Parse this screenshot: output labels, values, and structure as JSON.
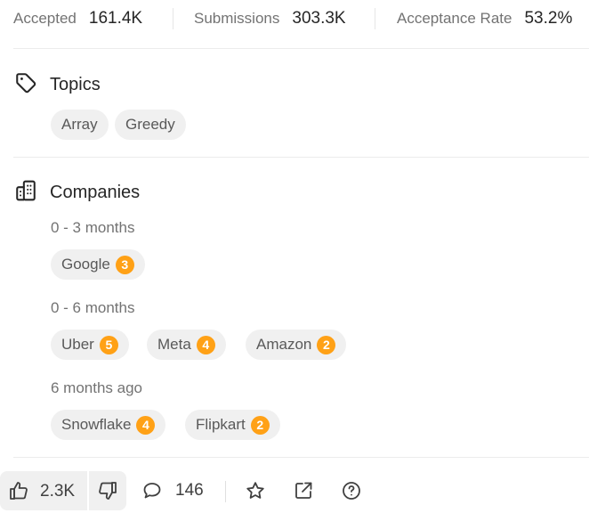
{
  "stats": [
    {
      "label": "Accepted",
      "value": "161.4K"
    },
    {
      "label": "Submissions",
      "value": "303.3K"
    },
    {
      "label": "Acceptance Rate",
      "value": "53.2%"
    }
  ],
  "topics": {
    "title": "Topics",
    "icon": "tag-icon",
    "items": [
      "Array",
      "Greedy"
    ]
  },
  "companies": {
    "title": "Companies",
    "icon": "building-icon",
    "groups": [
      {
        "period": "0 - 3 months",
        "items": [
          {
            "name": "Google",
            "count": "3"
          }
        ]
      },
      {
        "period": "0 - 6 months",
        "items": [
          {
            "name": "Uber",
            "count": "5"
          },
          {
            "name": "Meta",
            "count": "4"
          },
          {
            "name": "Amazon",
            "count": "2"
          }
        ]
      },
      {
        "period": "6 months ago",
        "items": [
          {
            "name": "Snowflake",
            "count": "4"
          },
          {
            "name": "Flipkart",
            "count": "2"
          }
        ]
      }
    ]
  },
  "actions": {
    "likes": "2.3K",
    "comments": "146",
    "icons": [
      "thumbs-up-icon",
      "thumbs-down-icon",
      "comment-icon",
      "star-icon",
      "external-link-icon",
      "help-circle-icon"
    ]
  },
  "colors": {
    "badge": "#ffa116",
    "chip_bg": "#f0f0f0",
    "muted_text": "#737373"
  }
}
